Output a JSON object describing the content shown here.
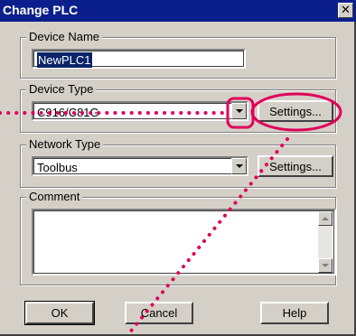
{
  "window": {
    "title": "Change PLC",
    "close_glyph": "✕"
  },
  "device_name": {
    "label": "Device Name",
    "value": "NewPLC1"
  },
  "device_type": {
    "label": "Device Type",
    "value": "C916/C81G",
    "settings_label": "Settings..."
  },
  "network_type": {
    "label": "Network Type",
    "value": "Toolbus",
    "settings_label": "Settings..."
  },
  "comment": {
    "label": "Comment",
    "value": ""
  },
  "buttons": {
    "ok": "OK",
    "cancel": "Cancel",
    "help": "Help"
  },
  "annotation": {
    "color": "#e0005a"
  },
  "colors": {
    "titlebar": "#0a1f8c",
    "face": "#d4d0c8",
    "selection": "#0a246a"
  }
}
